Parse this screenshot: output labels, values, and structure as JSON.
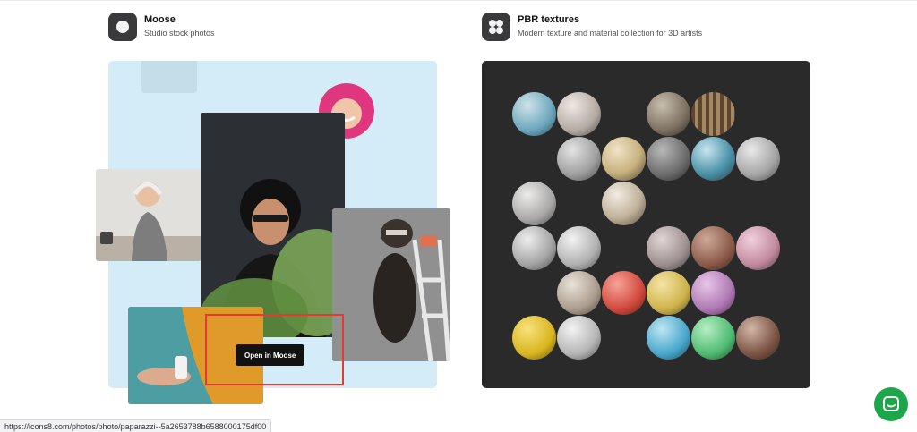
{
  "moose": {
    "title": "Moose",
    "subtitle": "Studio stock photos",
    "icon": "circle-app-icon",
    "action_label": "Open in Moose"
  },
  "pbr": {
    "title": "PBR textures",
    "subtitle": "Modern texture and material collection for 3D artists",
    "icon": "grid-four-circles-icon"
  },
  "status_url": "https://icons8.com/photos/photo/paparazzi--5a2653788b6588000175df00",
  "colors": {
    "moose_panel_bg": "#d3ecf7",
    "pbr_panel_bg": "#2a2a2b",
    "chat_button": "#1ea64a",
    "highlight_box": "#e53935"
  }
}
